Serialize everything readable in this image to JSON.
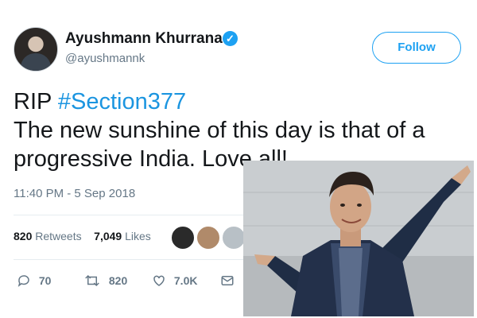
{
  "profile": {
    "name": "Ayushmann Khurrana",
    "handle": "@ayushmannk",
    "follow_label": "Follow",
    "avatar_icon": "profile-photo",
    "verified_icon": "verified-badge-icon"
  },
  "tweet": {
    "line1_prefix": "RIP ",
    "hashtag": "#Section377",
    "line2": "The new sunshine of this day is that of a",
    "line3": "progressive India. Lov",
    "line3_tail": "e all!",
    "timestamp": "11:40 PM - 5 Sep 2018"
  },
  "stats": {
    "retweets_count": "820",
    "retweets_label": "Retweets",
    "likes_count": "7,049",
    "likes_label": "Likes"
  },
  "actions": {
    "reply_count": "70",
    "retweet_count": "820",
    "like_count": "7.0K"
  },
  "colors": {
    "accent": "#1da1f2",
    "hashtag": "#1b95e0",
    "text": "#14171a",
    "muted": "#657786"
  }
}
